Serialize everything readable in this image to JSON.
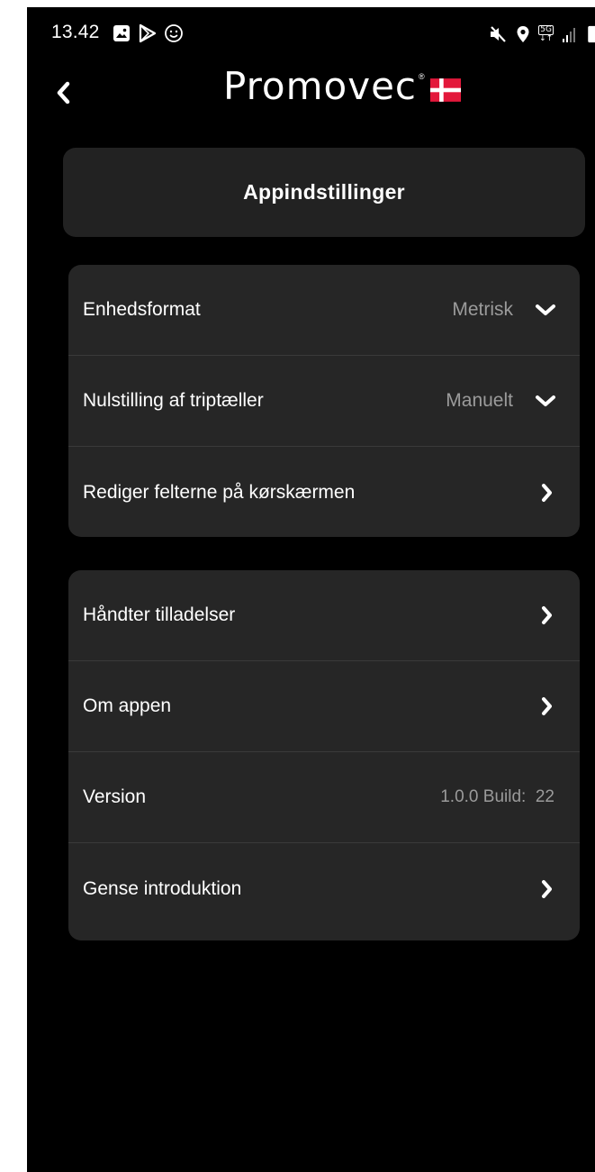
{
  "status_bar": {
    "time": "13.42",
    "left_icons": [
      "gallery-icon",
      "play-store-icon",
      "emoji-icon"
    ],
    "right_icons": [
      "mute-icon",
      "location-icon",
      "5g-icon",
      "signal-icon",
      "battery-icon"
    ],
    "network": "5G"
  },
  "header": {
    "back_icon": "chevron-left-icon",
    "logo_text": "Promovec",
    "logo_reg": "®",
    "flag": "denmark-flag"
  },
  "page": {
    "title": "Appindstillinger"
  },
  "group1": {
    "rows": [
      {
        "label": "Enhedsformat",
        "value": "Metrisk",
        "icon": "chevron-down-icon"
      },
      {
        "label": "Nulstilling af triptæller",
        "value": "Manuelt",
        "icon": "chevron-down-icon"
      },
      {
        "label": "Rediger felterne på kørskærmen",
        "value": "",
        "icon": "chevron-right-icon"
      }
    ]
  },
  "group2": {
    "rows": [
      {
        "label": "Håndter tilladelser",
        "value": "",
        "icon": "chevron-right-icon"
      },
      {
        "label": "Om appen",
        "value": "",
        "icon": "chevron-right-icon"
      },
      {
        "label": "Version",
        "value": "1.0.0 Build:  22",
        "icon": ""
      },
      {
        "label": "Gense introduktion",
        "value": "",
        "icon": "chevron-right-icon"
      }
    ]
  },
  "colors": {
    "background": "#000000",
    "card": "#262626",
    "title_card": "#222222",
    "text": "#ffffff",
    "muted_text": "#9b9b9b",
    "flag_red": "#e3183b"
  }
}
